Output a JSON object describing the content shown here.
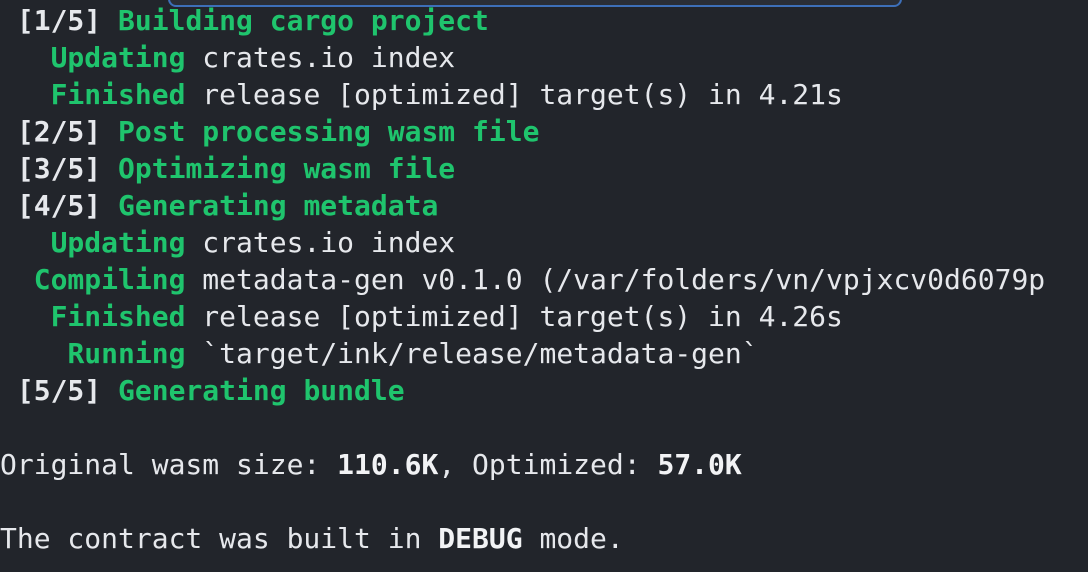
{
  "steps": [
    {
      "tag": "[1/5]",
      "label": "Building cargo project"
    },
    {
      "tag": "[2/5]",
      "label": "Post processing wasm file"
    },
    {
      "tag": "[3/5]",
      "label": "Optimizing wasm file"
    },
    {
      "tag": "[4/5]",
      "label": "Generating metadata"
    },
    {
      "tag": "[5/5]",
      "label": "Generating bundle"
    }
  ],
  "cargo": {
    "updating1": {
      "verb": "Updating",
      "text": " crates.io index"
    },
    "finished1": {
      "verb": "Finished",
      "text": " release [optimized] target(s) in 4.21s"
    },
    "updating2": {
      "verb": "Updating",
      "text": " crates.io index"
    },
    "compiling": {
      "verb": "Compiling",
      "text": " metadata-gen v0.1.0 (/var/folders/vn/vpjxcv0d6079p"
    },
    "finished2": {
      "verb": "Finished",
      "text": " release [optimized] target(s) in 4.26s"
    },
    "running": {
      "verb": "Running",
      "text": " `target/ink/release/metadata-gen`"
    }
  },
  "summary": {
    "orig_label": "Original wasm size: ",
    "orig_value": "110.6K",
    "opt_label": ", Optimized: ",
    "opt_value": "57.0K"
  },
  "mode_line": {
    "prefix": "The contract was built in ",
    "mode": "DEBUG",
    "suffix": " mode."
  },
  "colors": {
    "background": "#22252b",
    "accent_green": "#1fc46d",
    "text": "#e6e8ec"
  }
}
